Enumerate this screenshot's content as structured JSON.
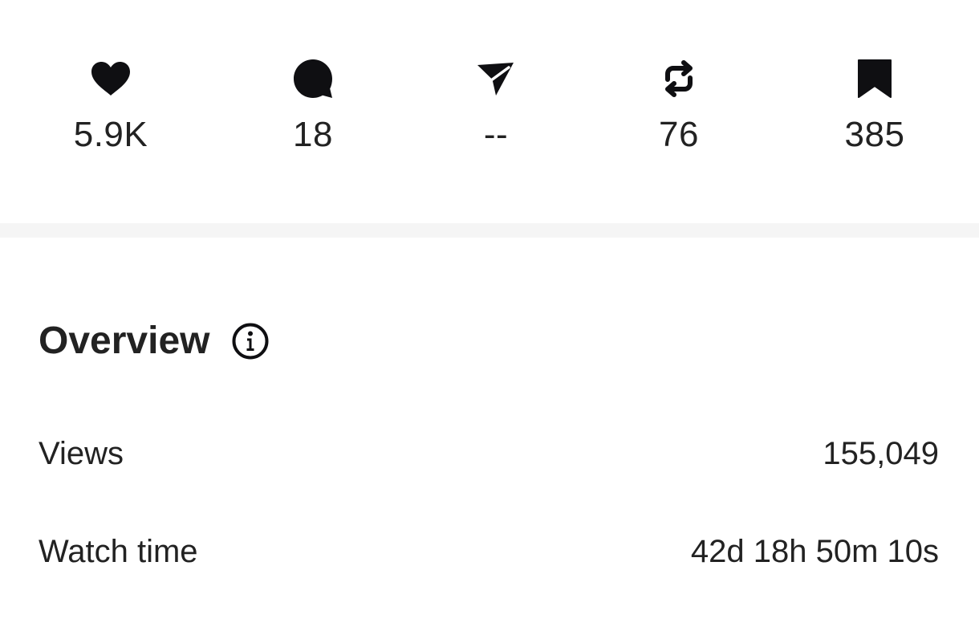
{
  "stats": [
    {
      "icon": "heart-icon",
      "value": "5.9K"
    },
    {
      "icon": "comment-icon",
      "value": "18"
    },
    {
      "icon": "send-icon",
      "value": "--"
    },
    {
      "icon": "repost-icon",
      "value": "76"
    },
    {
      "icon": "bookmark-icon",
      "value": "385"
    }
  ],
  "overview": {
    "title": "Overview",
    "info_icon": "info-icon",
    "metrics": [
      {
        "label": "Views",
        "value": "155,049"
      },
      {
        "label": "Watch time",
        "value": "42d 18h 50m 10s"
      }
    ]
  },
  "colors": {
    "icon": "#0f0f12",
    "text": "#222222",
    "divider": "#f5f5f5",
    "background": "#ffffff"
  }
}
